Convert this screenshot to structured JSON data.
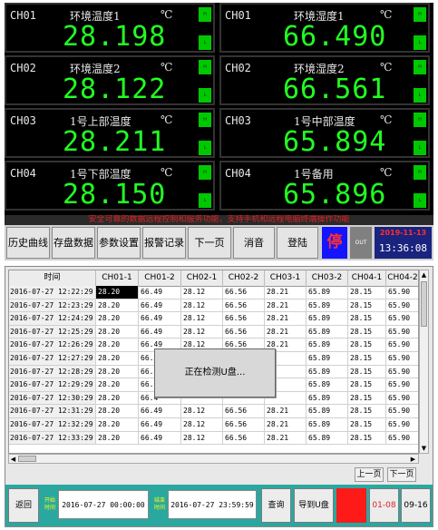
{
  "monitor": {
    "tiles": [
      {
        "ch": "CH01",
        "name": "环境温度1",
        "unit": "℃",
        "value": "28.198",
        "h": "H",
        "l": "L"
      },
      {
        "ch": "CH01",
        "name": "环境湿度1",
        "unit": "℃",
        "value": "66.490",
        "h": "H",
        "l": "L"
      },
      {
        "ch": "CH02",
        "name": "环境温度2",
        "unit": "℃",
        "value": "28.122",
        "h": "H",
        "l": "L"
      },
      {
        "ch": "CH02",
        "name": "环境湿度2",
        "unit": "℃",
        "value": "66.561",
        "h": "H",
        "l": "L"
      },
      {
        "ch": "CH03",
        "name": "1号上部温度",
        "unit": "℃",
        "value": "28.211",
        "h": "H",
        "l": "L"
      },
      {
        "ch": "CH03",
        "name": "1号中部温度",
        "unit": "℃",
        "value": "65.894",
        "h": "H",
        "l": "L"
      },
      {
        "ch": "CH04",
        "name": "1号下部温度",
        "unit": "℃",
        "value": "28.150",
        "h": "H",
        "l": "L"
      },
      {
        "ch": "CH04",
        "name": "1号备用",
        "unit": "℃",
        "value": "65.896",
        "h": "H",
        "l": "L"
      }
    ],
    "notice": "安全可靠的数据远程控制和服务功能，支持手机和远程电脑终端操作功能",
    "buttons": [
      "历史曲线",
      "存盘数据",
      "参数设置",
      "报警记录",
      "下一页",
      "消音",
      "登陆"
    ],
    "stop_label": "停",
    "out_label": "OUT",
    "date": "2019-11-13",
    "time": "13:36:08"
  },
  "history": {
    "columns": [
      "时间",
      "CH01-1",
      "CH01-2",
      "CH02-1",
      "CH02-2",
      "CH03-1",
      "CH03-2",
      "CH04-1",
      "CH04-2"
    ],
    "rows": [
      [
        "2016-07-27 12:22:29",
        "28.20",
        "66.49",
        "28.12",
        "66.56",
        "28.21",
        "65.89",
        "28.15",
        "65.90"
      ],
      [
        "2016-07-27 12:23:29",
        "28.20",
        "66.49",
        "28.12",
        "66.56",
        "28.21",
        "65.89",
        "28.15",
        "65.90"
      ],
      [
        "2016-07-27 12:24:29",
        "28.20",
        "66.49",
        "28.12",
        "66.56",
        "28.21",
        "65.89",
        "28.15",
        "65.90"
      ],
      [
        "2016-07-27 12:25:29",
        "28.20",
        "66.49",
        "28.12",
        "66.56",
        "28.21",
        "65.89",
        "28.15",
        "65.90"
      ],
      [
        "2016-07-27 12:26:29",
        "28.20",
        "66.49",
        "28.12",
        "66.56",
        "28.21",
        "65.89",
        "28.15",
        "65.90"
      ],
      [
        "2016-07-27 12:27:29",
        "28.20",
        "66.4",
        "",
        "",
        "",
        "65.89",
        "28.15",
        "65.90"
      ],
      [
        "2016-07-27 12:28:29",
        "28.20",
        "66.4",
        "",
        "",
        "",
        "65.89",
        "28.15",
        "65.90"
      ],
      [
        "2016-07-27 12:29:29",
        "28.20",
        "66.4",
        "",
        "",
        "",
        "65.89",
        "28.15",
        "65.90"
      ],
      [
        "2016-07-27 12:30:29",
        "28.20",
        "66.4",
        "",
        "",
        "",
        "65.89",
        "28.15",
        "65.90"
      ],
      [
        "2016-07-27 12:31:29",
        "28.20",
        "66.49",
        "28.12",
        "66.56",
        "28.21",
        "65.89",
        "28.15",
        "65.90"
      ],
      [
        "2016-07-27 12:32:29",
        "28.20",
        "66.49",
        "28.12",
        "66.56",
        "28.21",
        "65.89",
        "28.15",
        "65.90"
      ],
      [
        "2016-07-27 12:33:29",
        "28.20",
        "66.49",
        "28.12",
        "66.56",
        "28.21",
        "65.89",
        "28.15",
        "65.90"
      ]
    ],
    "popup": "正在检测U盘...",
    "prev_page": "上一页",
    "next_page": "下一页",
    "back": "返回",
    "start_label": "开始时间",
    "start": "2016-07-27 00:00:00",
    "end_label": "结束时间",
    "end": "2016-07-27 23:59:59",
    "query": "查询",
    "export": "导到U盘",
    "record_label": " ",
    "range1": "01-08",
    "range2": "09-16"
  }
}
